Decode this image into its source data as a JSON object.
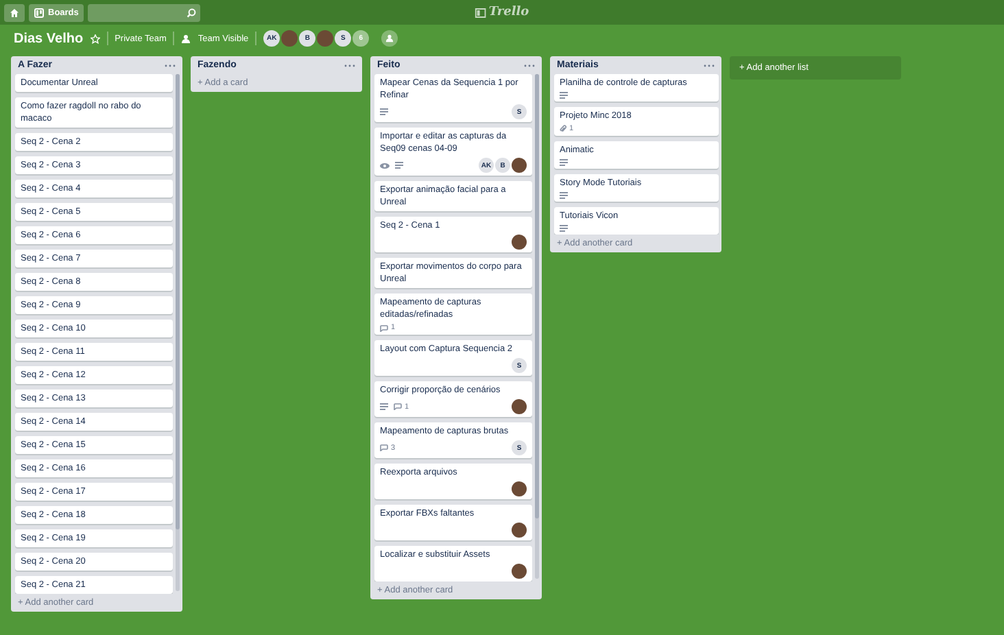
{
  "topbar": {
    "boards_label": "Boards",
    "logo": "Trello"
  },
  "board": {
    "title": "Dias Velho",
    "starred": false,
    "team": "Private Team",
    "visibility": "Team Visible",
    "members": [
      {
        "kind": "initials",
        "text": "AK"
      },
      {
        "kind": "photo"
      },
      {
        "kind": "initials",
        "text": "B"
      },
      {
        "kind": "photo"
      },
      {
        "kind": "initials",
        "text": "S"
      },
      {
        "kind": "count",
        "text": "6"
      }
    ]
  },
  "lists": [
    {
      "title": "A Fazer",
      "add_label": "+ Add another card",
      "cards": [
        {
          "title": "Documentar Unreal"
        },
        {
          "title": "Como fazer ragdoll no rabo do macaco"
        },
        {
          "title": "Seq 2 - Cena 2"
        },
        {
          "title": "Seq 2 - Cena 3"
        },
        {
          "title": "Seq 2 - Cena 4"
        },
        {
          "title": "Seq 2 - Cena 5"
        },
        {
          "title": "Seq 2 - Cena 6"
        },
        {
          "title": "Seq 2 - Cena 7"
        },
        {
          "title": "Seq 2 - Cena 8"
        },
        {
          "title": "Seq 2 - Cena 9"
        },
        {
          "title": "Seq 2 - Cena 10"
        },
        {
          "title": "Seq 2 - Cena 11"
        },
        {
          "title": "Seq 2 - Cena 12"
        },
        {
          "title": "Seq 2 - Cena 13"
        },
        {
          "title": "Seq 2 - Cena 14"
        },
        {
          "title": "Seq 2 - Cena 15"
        },
        {
          "title": "Seq 2 - Cena 16"
        },
        {
          "title": "Seq 2 - Cena 17"
        },
        {
          "title": "Seq 2 - Cena 18"
        },
        {
          "title": "Seq 2 - Cena 19"
        },
        {
          "title": "Seq 2 - Cena 20"
        },
        {
          "title": "Seq 2 - Cena 21"
        }
      ]
    },
    {
      "title": "Fazendo",
      "add_label": "+ Add a card"
    },
    {
      "title": "Feito",
      "add_label": "+ Add another card",
      "cards": [
        {
          "title": "Mapear Cenas da Sequencia 1 por Refinar",
          "badges": [
            {
              "kind": "description"
            }
          ],
          "members": [
            {
              "kind": "initials",
              "text": "S"
            }
          ]
        },
        {
          "title": "Importar e editar as capturas da Seq09 cenas 04-09",
          "badges": [
            {
              "kind": "watch"
            },
            {
              "kind": "description"
            }
          ],
          "members": [
            {
              "kind": "initials",
              "text": "AK"
            },
            {
              "kind": "initials",
              "text": "B"
            },
            {
              "kind": "photo"
            }
          ]
        },
        {
          "title": "Exportar animação facial para a Unreal"
        },
        {
          "title": "Seq 2 - Cena 1",
          "members": [
            {
              "kind": "photo"
            }
          ]
        },
        {
          "title": "Exportar movimentos do corpo para Unreal"
        },
        {
          "title": "Mapeamento de capturas editadas/refinadas",
          "badges": [
            {
              "kind": "comment",
              "text": "1"
            }
          ]
        },
        {
          "title": "Layout com Captura Sequencia 2",
          "members": [
            {
              "kind": "initials",
              "text": "S"
            }
          ]
        },
        {
          "title": "Corrigir proporção de cenários",
          "badges": [
            {
              "kind": "description"
            },
            {
              "kind": "comment",
              "text": "1"
            }
          ],
          "members": [
            {
              "kind": "photo"
            }
          ]
        },
        {
          "title": "Mapeamento de capturas brutas",
          "badges": [
            {
              "kind": "comment",
              "text": "3"
            }
          ],
          "members": [
            {
              "kind": "initials",
              "text": "S"
            }
          ]
        },
        {
          "title": "Reexporta arquivos",
          "members": [
            {
              "kind": "photo"
            }
          ]
        },
        {
          "title": "Exportar FBXs faltantes",
          "members": [
            {
              "kind": "photo"
            }
          ]
        },
        {
          "title": "Localizar e substituir Assets",
          "members": [
            {
              "kind": "photo"
            }
          ]
        }
      ]
    },
    {
      "title": "Materiais",
      "add_label": "+ Add another card",
      "cards": [
        {
          "title": "Planilha de controle de capturas",
          "badges": [
            {
              "kind": "description"
            }
          ]
        },
        {
          "title": "Projeto Minc 2018",
          "badges": [
            {
              "kind": "attachment",
              "text": "1"
            }
          ]
        },
        {
          "title": "Animatic",
          "badges": [
            {
              "kind": "description"
            }
          ]
        },
        {
          "title": "Story Mode Tutoriais",
          "badges": [
            {
              "kind": "description"
            }
          ]
        },
        {
          "title": "Tutoriais Vicon",
          "badges": [
            {
              "kind": "description"
            }
          ]
        }
      ]
    }
  ],
  "add_list_label": "+ Add another list"
}
